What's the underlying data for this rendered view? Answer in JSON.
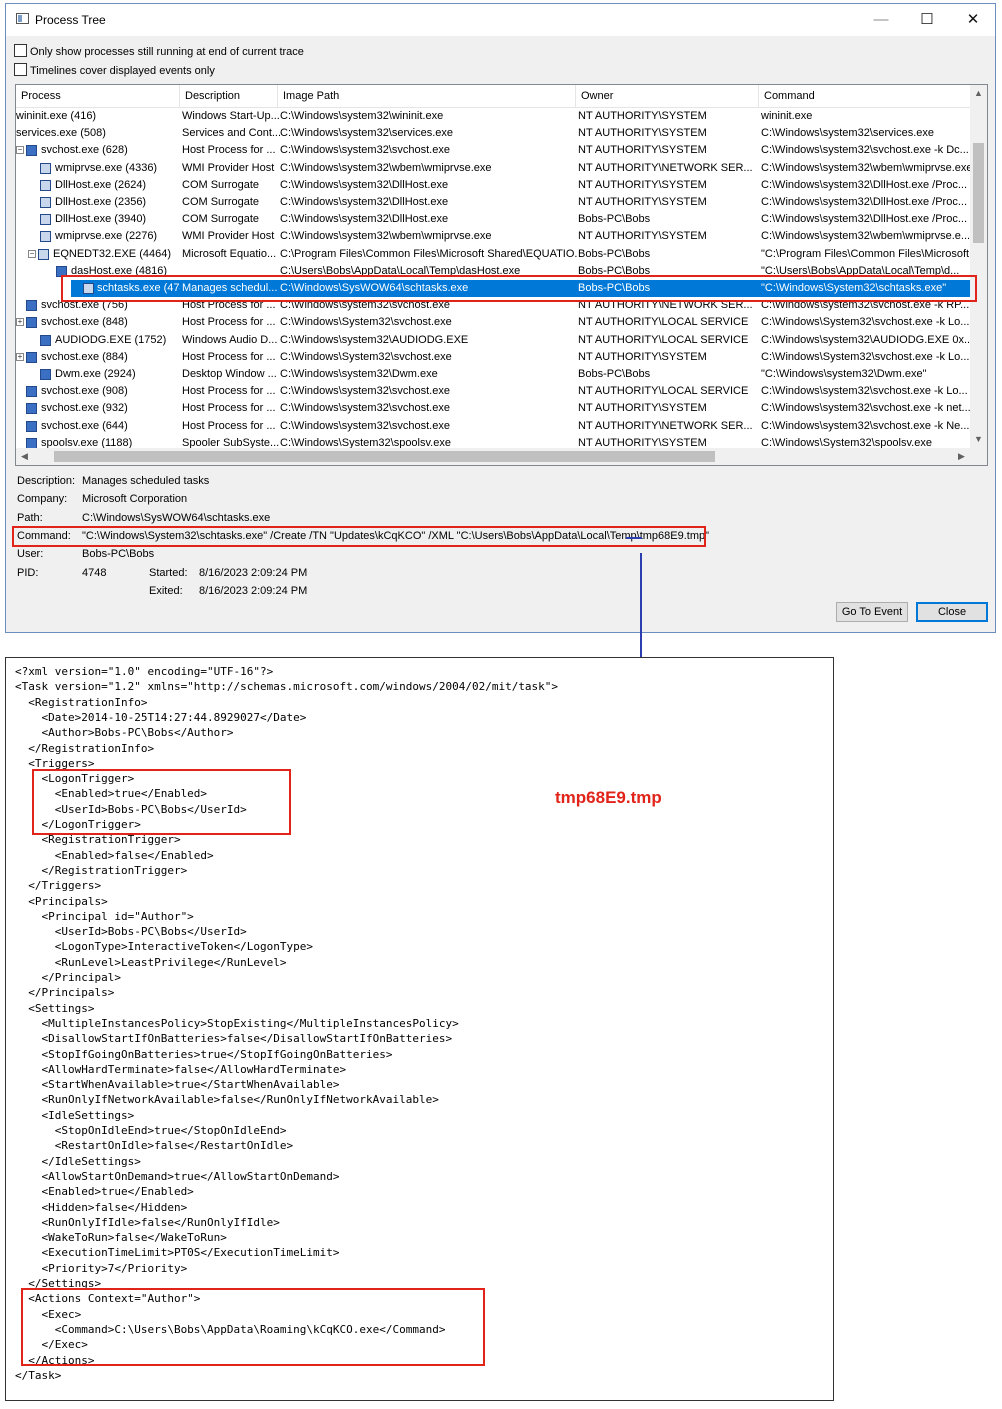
{
  "window": {
    "title": "Process Tree",
    "minimize": "—",
    "maximize": "☐",
    "close": "✕",
    "options": [
      {
        "label": "Only show processes still running at end of current trace",
        "checked": false
      },
      {
        "label": "Timelines cover displayed events only",
        "checked": false
      }
    ]
  },
  "columns": [
    "Process",
    "Description",
    "Image Path",
    "Owner",
    "Command"
  ],
  "processes": [
    {
      "name": "wininit.exe (416)",
      "desc": "Windows Start-Up...",
      "path": "C:\\Windows\\system32\\wininit.exe",
      "owner": "NT AUTHORITY\\SYSTEM",
      "cmd": "wininit.exe"
    },
    {
      "name": "services.exe (508)",
      "desc": "Services and Cont...",
      "path": "C:\\Windows\\system32\\services.exe",
      "owner": "NT AUTHORITY\\SYSTEM",
      "cmd": "C:\\Windows\\system32\\services.exe"
    },
    {
      "name": "svchost.exe (628)",
      "desc": "Host Process for ...",
      "path": "C:\\Windows\\system32\\svchost.exe",
      "owner": "NT AUTHORITY\\SYSTEM",
      "cmd": "C:\\Windows\\system32\\svchost.exe -k Dc..."
    },
    {
      "name": "wmiprvse.exe (4336)",
      "desc": "WMI Provider Host",
      "path": "C:\\Windows\\system32\\wbem\\wmiprvse.exe",
      "owner": "NT AUTHORITY\\NETWORK SER...",
      "cmd": "C:\\Windows\\system32\\wbem\\wmiprvse.exe"
    },
    {
      "name": "DllHost.exe (2624)",
      "desc": "COM Surrogate",
      "path": "C:\\Windows\\system32\\DllHost.exe",
      "owner": "NT AUTHORITY\\SYSTEM",
      "cmd": "C:\\Windows\\system32\\DllHost.exe /Proc..."
    },
    {
      "name": "DllHost.exe (2356)",
      "desc": "COM Surrogate",
      "path": "C:\\Windows\\system32\\DllHost.exe",
      "owner": "NT AUTHORITY\\SYSTEM",
      "cmd": "C:\\Windows\\system32\\DllHost.exe /Proc..."
    },
    {
      "name": "DllHost.exe (3940)",
      "desc": "COM Surrogate",
      "path": "C:\\Windows\\system32\\DllHost.exe",
      "owner": "Bobs-PC\\Bobs",
      "cmd": "C:\\Windows\\system32\\DllHost.exe /Proc..."
    },
    {
      "name": "wmiprvse.exe (2276)",
      "desc": "WMI Provider Host",
      "path": "C:\\Windows\\system32\\wbem\\wmiprvse.exe",
      "owner": "NT AUTHORITY\\SYSTEM",
      "cmd": "C:\\Windows\\system32\\wbem\\wmiprvse.e..."
    },
    {
      "name": "EQNEDT32.EXE (4464)",
      "desc": "Microsoft Equatio...",
      "path": "C:\\Program Files\\Common Files\\Microsoft Shared\\EQUATIO...",
      "owner": "Bobs-PC\\Bobs",
      "cmd": "\"C:\\Program Files\\Common Files\\Microsoft..."
    },
    {
      "name": "dasHost.exe (4816)",
      "desc": "",
      "path": "C:\\Users\\Bobs\\AppData\\Local\\Temp\\dasHost.exe",
      "owner": "Bobs-PC\\Bobs",
      "cmd": "\"C:\\Users\\Bobs\\AppData\\Local\\Temp\\d..."
    },
    {
      "name": "schtasks.exe (4748)",
      "desc": "Manages schedul...",
      "path": "C:\\Windows\\SysWOW64\\schtasks.exe",
      "owner": "Bobs-PC\\Bobs",
      "cmd": "\"C:\\Windows\\System32\\schtasks.exe\""
    },
    {
      "name": "svchost.exe (756)",
      "desc": "Host Process for ...",
      "path": "C:\\Windows\\system32\\svchost.exe",
      "owner": "NT AUTHORITY\\NETWORK SER...",
      "cmd": "C:\\Windows\\system32\\svchost.exe -k RP..."
    },
    {
      "name": "svchost.exe (848)",
      "desc": "Host Process for ...",
      "path": "C:\\Windows\\System32\\svchost.exe",
      "owner": "NT AUTHORITY\\LOCAL SERVICE",
      "cmd": "C:\\Windows\\System32\\svchost.exe -k Lo..."
    },
    {
      "name": "AUDIODG.EXE (1752)",
      "desc": "Windows Audio D...",
      "path": "C:\\Windows\\system32\\AUDIODG.EXE",
      "owner": "NT AUTHORITY\\LOCAL SERVICE",
      "cmd": "C:\\Windows\\system32\\AUDIODG.EXE 0x..."
    },
    {
      "name": "svchost.exe (884)",
      "desc": "Host Process for ...",
      "path": "C:\\Windows\\System32\\svchost.exe",
      "owner": "NT AUTHORITY\\SYSTEM",
      "cmd": "C:\\Windows\\System32\\svchost.exe -k Lo..."
    },
    {
      "name": "Dwm.exe (2924)",
      "desc": "Desktop Window ...",
      "path": "C:\\Windows\\system32\\Dwm.exe",
      "owner": "Bobs-PC\\Bobs",
      "cmd": "\"C:\\Windows\\system32\\Dwm.exe\""
    },
    {
      "name": "svchost.exe (908)",
      "desc": "Host Process for ...",
      "path": "C:\\Windows\\system32\\svchost.exe",
      "owner": "NT AUTHORITY\\LOCAL SERVICE",
      "cmd": "C:\\Windows\\system32\\svchost.exe -k Lo..."
    },
    {
      "name": "svchost.exe (932)",
      "desc": "Host Process for ...",
      "path": "C:\\Windows\\system32\\svchost.exe",
      "owner": "NT AUTHORITY\\SYSTEM",
      "cmd": "C:\\Windows\\system32\\svchost.exe -k net..."
    },
    {
      "name": "svchost.exe (644)",
      "desc": "Host Process for ...",
      "path": "C:\\Windows\\system32\\svchost.exe",
      "owner": "NT AUTHORITY\\NETWORK SER...",
      "cmd": "C:\\Windows\\system32\\svchost.exe -k Ne..."
    },
    {
      "name": "spoolsv.exe (1188)",
      "desc": "Spooler SubSyste...",
      "path": "C:\\Windows\\System32\\spoolsv.exe",
      "owner": "NT AUTHORITY\\SYSTEM",
      "cmd": "C:\\Windows\\System32\\spoolsv.exe"
    }
  ],
  "selected_process": "schtasks.exe (4748)",
  "details": {
    "description_label": "Description:",
    "description": "Manages scheduled tasks",
    "company_label": "Company:",
    "company": "Microsoft Corporation",
    "path_label": "Path:",
    "path": "C:\\Windows\\SysWOW64\\schtasks.exe",
    "command_label": "Command:",
    "command": "\"C:\\Windows\\System32\\schtasks.exe\" /Create /TN \"Updates\\kCqKCO\" /XML \"C:\\Users\\Bobs\\AppData\\Local\\Temp\\tmp68E9.tmp\"",
    "user_label": "User:",
    "user": "Bobs-PC\\Bobs",
    "pid_label": "PID:",
    "pid": "4748",
    "started_label": "Started:",
    "started": "8/16/2023 2:09:24 PM",
    "exited_label": "Exited:",
    "exited": "8/16/2023 2:09:24 PM"
  },
  "buttons": {
    "goto": "Go To Event",
    "close": "Close"
  },
  "xml_file_label": "tmp68E9.tmp",
  "xml_lines": [
    "<?xml version=\"1.0\" encoding=\"UTF-16\"?>",
    "<Task version=\"1.2\" xmlns=\"http://schemas.microsoft.com/windows/2004/02/mit/task\">",
    "  <RegistrationInfo>",
    "    <Date>2014-10-25T14:27:44.8929027</Date>",
    "    <Author>Bobs-PC\\Bobs</Author>",
    "  </RegistrationInfo>",
    "  <Triggers>",
    "    <LogonTrigger>",
    "      <Enabled>true</Enabled>",
    "      <UserId>Bobs-PC\\Bobs</UserId>",
    "    </LogonTrigger>",
    "    <RegistrationTrigger>",
    "      <Enabled>false</Enabled>",
    "    </RegistrationTrigger>",
    "  </Triggers>",
    "  <Principals>",
    "    <Principal id=\"Author\">",
    "      <UserId>Bobs-PC\\Bobs</UserId>",
    "      <LogonType>InteractiveToken</LogonType>",
    "      <RunLevel>LeastPrivilege</RunLevel>",
    "    </Principal>",
    "  </Principals>",
    "  <Settings>",
    "    <MultipleInstancesPolicy>StopExisting</MultipleInstancesPolicy>",
    "    <DisallowStartIfOnBatteries>false</DisallowStartIfOnBatteries>",
    "    <StopIfGoingOnBatteries>true</StopIfGoingOnBatteries>",
    "    <AllowHardTerminate>false</AllowHardTerminate>",
    "    <StartWhenAvailable>true</StartWhenAvailable>",
    "    <RunOnlyIfNetworkAvailable>false</RunOnlyIfNetworkAvailable>",
    "    <IdleSettings>",
    "      <StopOnIdleEnd>true</StopOnIdleEnd>",
    "      <RestartOnIdle>false</RestartOnIdle>",
    "    </IdleSettings>",
    "    <AllowStartOnDemand>true</AllowStartOnDemand>",
    "    <Enabled>true</Enabled>",
    "    <Hidden>false</Hidden>",
    "    <RunOnlyIfIdle>false</RunOnlyIfIdle>",
    "    <WakeToRun>false</WakeToRun>",
    "    <ExecutionTimeLimit>PT0S</ExecutionTimeLimit>",
    "    <Priority>7</Priority>",
    "  </Settings>",
    "  <Actions Context=\"Author\">",
    "    <Exec>",
    "      <Command>C:\\Users\\Bobs\\AppData\\Roaming\\kCqKCO.exe</Command>",
    "    </Exec>",
    "  </Actions>",
    "</Task>"
  ],
  "colors": {
    "selection": "#0078d7",
    "highlight_box": "#e2231a",
    "arrow": "#2b3fb3"
  },
  "icons": [
    "window-icon",
    "process-icon",
    "expand-icon",
    "collapse-icon",
    "scroll-arrow-icon",
    "down-arrow-icon"
  ]
}
